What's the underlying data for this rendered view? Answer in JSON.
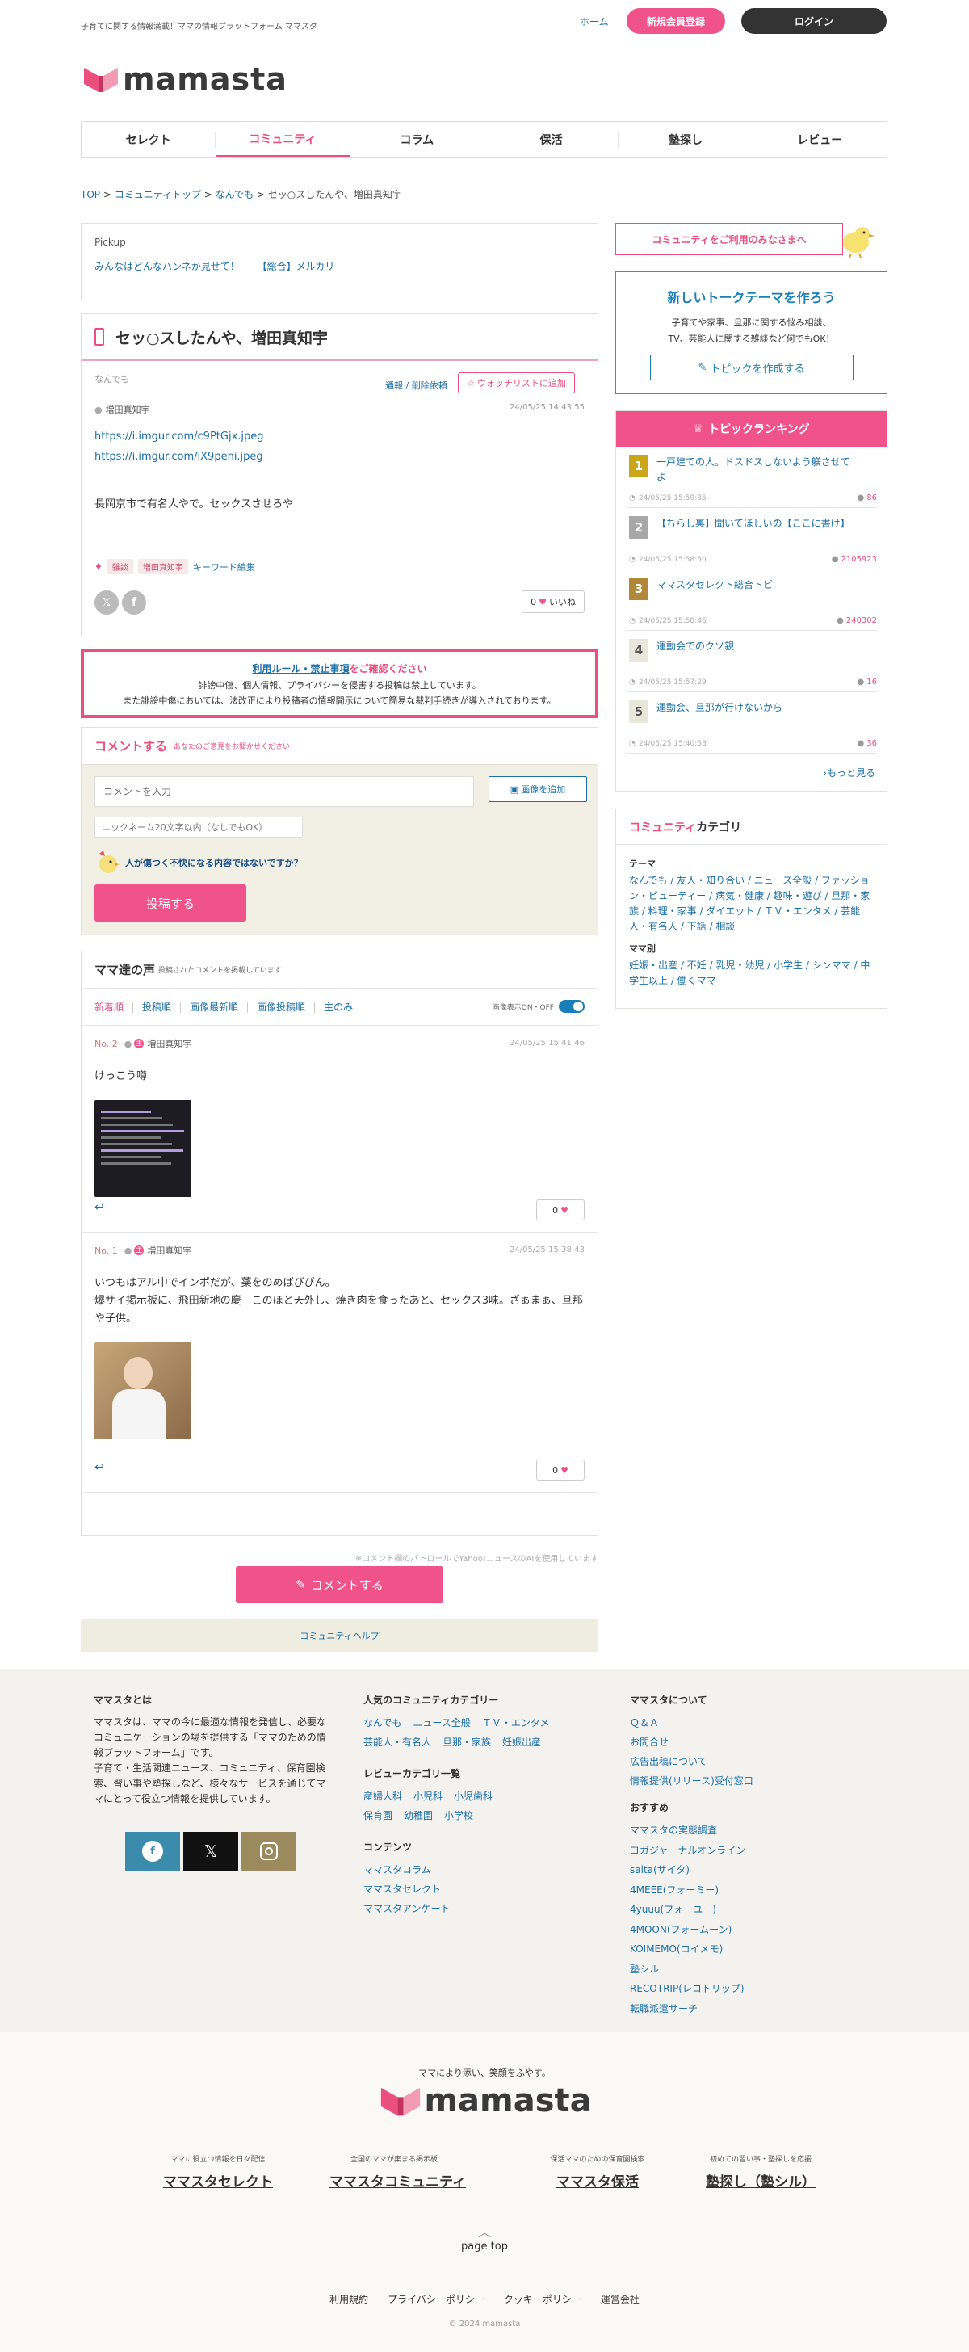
{
  "header": {
    "tagline": "子育てに関する情報満載！ママの情報プラットフォーム ママスタ",
    "home": "ホーム",
    "register": "新規会員登録",
    "login": "ログイン",
    "logo": "mamasta"
  },
  "nav": [
    "セレクト",
    "コミュニティ",
    "コラム",
    "保活",
    "塾探し",
    "レビュー"
  ],
  "breadcrumb": {
    "top": "TOP",
    "community_top": "コミュニティトップ",
    "category": "なんでも",
    "current": "セッ○スしたんや、増田真知宇",
    "sep": " > "
  },
  "pickup": {
    "title": "Pickup",
    "items": [
      "みんなはどんなハンネか見せて！",
      "【総合】メルカリ"
    ]
  },
  "post": {
    "title": "セッ○スしたんや、増田真知宇",
    "category": "なんでも",
    "report": "通報 / 削除依頼",
    "watch": "ウォッチリストに追加",
    "author": "増田真知宇",
    "date": "24/05/25 14:43:55",
    "links": [
      "https://i.imgur.com/c9PtGjx.jpeg",
      "https://i.imgur.com/iX9peni.jpeg"
    ],
    "body": "長岡京市で有名人やで。セックスさせろや",
    "tags": [
      "雑談",
      "増田真知宇"
    ],
    "keyword_edit": "キーワード編集",
    "likes": "0",
    "like_label": "いいね"
  },
  "rules": {
    "title_link": "利用ルール・禁止事項",
    "title_rest": "をご確認ください",
    "line1": "誹謗中傷、個人情報、プライバシーを侵害する投稿は禁止しています。",
    "line2": "また誹謗中傷においては、法改正により投稿者の情報開示について簡易な裁判手続きが導入されております。"
  },
  "comment_form": {
    "title": "コメントする",
    "subtitle": "あなたのご意見をお聞かせください",
    "input_placeholder": "コメントを入力",
    "add_image": "画像を追加",
    "nickname_placeholder": "ニックネーム20文字以内（なしでもOK）",
    "warning": "人が傷つく不快になる内容ではないですか？",
    "submit": "投稿する"
  },
  "voices": {
    "title": "ママ達の声",
    "subtitle": "投稿されたコメントを掲載しています",
    "filters": [
      "新着順",
      "投稿順",
      "画像最新順",
      "画像投稿順",
      "主のみ"
    ],
    "image_toggle": "画像表示ON・OFF",
    "comments": [
      {
        "no": "No. 2",
        "author": "増田真知宇",
        "date": "24/05/25 15:41:46",
        "body": "けっこう噂",
        "likes": "0",
        "img": "screenshot"
      },
      {
        "no": "No. 1",
        "author": "増田真知宇",
        "date": "24/05/25 15:38:43",
        "body": "いつもはアル中でインポだが、薬をのめばびびん。\n爆サイ掲示板に、飛田新地の慶　このほと天外し、焼き肉を食ったあと、セックス3味。ざぁまぁ、旦那や子供。",
        "likes": "0",
        "img": "photo"
      }
    ],
    "patrol_note": "※コメント欄のパトロールでYahoo!ニュースのAIを使用しています",
    "comment_button": "コメントする",
    "help": "コミュニティヘルプ"
  },
  "sidebar": {
    "users_btn": "コミュニティをご利用のみなさまへ",
    "new_theme_title": "新しいトークテーマを作ろう",
    "new_theme_desc1": "子育てや家事、旦那に関する悩み相談、",
    "new_theme_desc2": "TV、芸能人に関する雑談など何でもOK！",
    "new_theme_btn": "トピックを作成する",
    "ranking_title": "トピックランキング",
    "ranking": [
      {
        "rank": "1",
        "title": "一戸建ての人。ドスドスしないよう躾させてよ",
        "date": "24/05/25 15:59:35",
        "count": "86",
        "color": "#c9a61a"
      },
      {
        "rank": "2",
        "title": "【ちらし裏】聞いてほしいの【ここに書け】",
        "date": "24/05/25 15:58:50",
        "count": "2105923",
        "color": "#a8a8a8"
      },
      {
        "rank": "3",
        "title": "ママスタセレクト総合トピ",
        "date": "24/05/25 15:58:46",
        "count": "240302",
        "color": "#b0883a"
      },
      {
        "rank": "4",
        "title": "運動会でのクソ親",
        "date": "24/05/25 15:57:29",
        "count": "16",
        "color": "#e9e6da"
      },
      {
        "rank": "5",
        "title": "運動会、旦那が行けないから",
        "date": "24/05/25 15:40:53",
        "count": "36",
        "color": "#e9e6da"
      }
    ],
    "more": "もっと見る",
    "cat_title_pink": "コミュニティ",
    "cat_title_rest": "カテゴリ",
    "theme_label": "テーマ",
    "theme_text": "なんでも / 友人・知り合い / ニュース全般 / ファッション・ビューティー / 病気・健康 / 趣味・遊び / 旦那・家族 / 料理・家事 / ダイエット / ＴＶ・エンタメ / 芸能人・有名人 / 下話 / 相談",
    "mama_label": "ママ別",
    "mama_text": "妊娠・出産 / 不妊 / 乳児・幼児 / 小学生 / シンママ / 中学生以上 / 働くママ"
  },
  "footer": {
    "about_title": "ママスタとは",
    "about_text": "ママスタは、ママの今に最適な情報を発信し、必要なコミュニケーションの場を提供する「ママのための情報プラットフォーム」です。\n子育て・生活関連ニュース、コミュニティ、保育園検索、習い事や塾探しなど、様々なサービスを通じてママにとって役立つ情報を提供しています。",
    "popular_title": "人気のコミュニティカテゴリー",
    "popular_links": [
      "なんでも",
      "ニュース全般",
      "ＴＶ・エンタメ",
      "芸能人・有名人",
      "旦那・家族",
      "妊娠出産"
    ],
    "review_title": "レビューカテゴリ一覧",
    "review_links": [
      "産婦人科",
      "小児科",
      "小児歯科",
      "保育園",
      "幼稚園",
      "小学校"
    ],
    "contents_title": "コンテンツ",
    "contents_links": [
      "ママスタコラム",
      "ママスタセレクト",
      "ママスタアンケート"
    ],
    "about_links_title": "ママスタについて",
    "about_links": [
      "Ｑ＆Ａ",
      "お問合せ",
      "広告出稿について",
      "情報提供(リリース)受付窓口"
    ],
    "recommend_title": "おすすめ",
    "recommend_links": [
      "ママスタの実態調査",
      "ヨガジャーナルオンライン",
      "saita(サイタ)",
      "4MEEE(フォーミー)",
      "4yuuu(フォーユー)",
      "4MOON(フォームーン)",
      "KOIMEMO(コイメモ)",
      "塾シル",
      "RECOTRIP(レコトリップ)",
      "転職派遣サーチ"
    ],
    "slogan": "ママにより添い、笑顔をふやす。",
    "logo": "mamasta",
    "services": [
      {
        "caption": "ママに役立つ情報を日々配信",
        "name": "ママスタセレクト"
      },
      {
        "caption": "全国のママが集まる掲示板",
        "name": "ママスタコミュニティ"
      },
      {
        "caption": "保活ママのための保育園検索",
        "name": "ママスタ保活"
      },
      {
        "caption": "初めての習い事・塾探しを応援",
        "name": "塾探し（塾シル）"
      }
    ],
    "page_top": "page top",
    "bottom_links": [
      "利用規約",
      "プライバシーポリシー",
      "クッキーポリシー",
      "運営会社"
    ],
    "copyright": "© 2024 mamasta"
  }
}
